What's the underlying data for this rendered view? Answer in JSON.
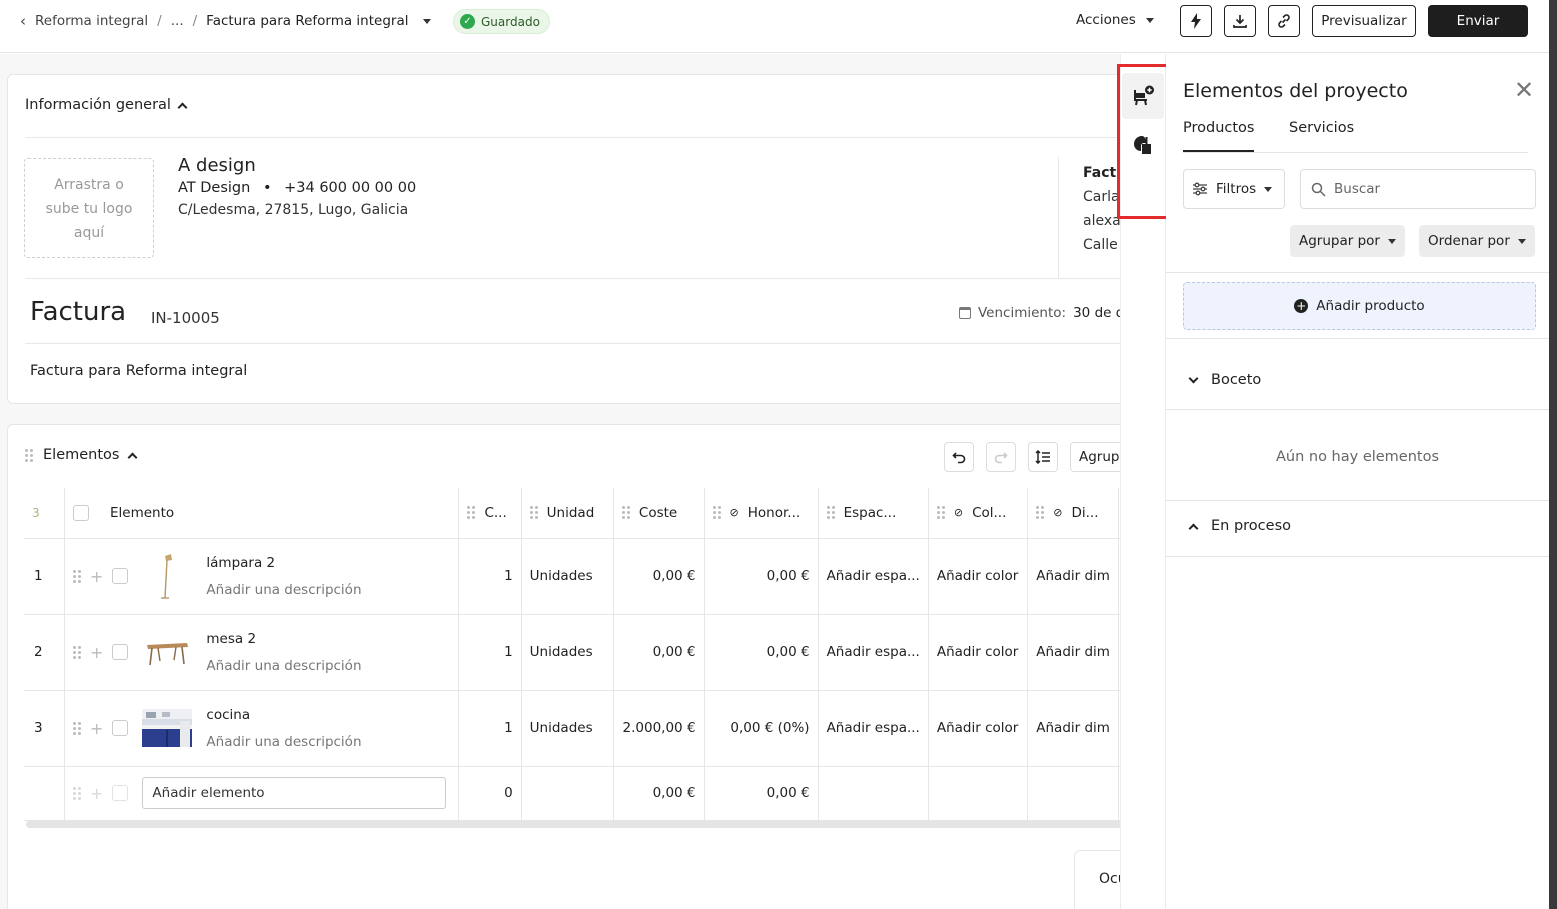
{
  "topbar": {
    "breadcrumb": [
      "Reforma integral",
      "...",
      "Factura para Reforma integral"
    ],
    "saved_label": "Guardado",
    "actions_label": "Acciones",
    "preview_label": "Previsualizar",
    "send_label": "Enviar"
  },
  "general": {
    "title": "Información general",
    "logo_placeholder": "Arrastra o sube tu logo aquí",
    "company_name": "A design",
    "company_legal": "AT Design",
    "company_phone": "+34 600 00 00 00",
    "company_address": "C/Ledesma, 27815, Lugo, Galicia",
    "client_peek": [
      "Fact",
      "Carla",
      "alexa",
      "Calle"
    ]
  },
  "invoice": {
    "title": "Factura",
    "number": "IN-10005",
    "due_label": "Vencimiento:",
    "due_value": "30 de d",
    "description": "Factura para Reforma integral"
  },
  "elements": {
    "title": "Elementos",
    "group_button": "Agrupa",
    "count": "3",
    "columns": [
      "Elemento",
      "C...",
      "Unidad",
      "Coste",
      "Honor...",
      "Espac...",
      "Col...",
      "Di..."
    ],
    "rows": [
      {
        "index": "1",
        "name": "lámpara 2",
        "desc": "Añadir una descripción",
        "qty": "1",
        "unit": "Unidades",
        "cost": "0,00 €",
        "fee": "0,00 €",
        "space": "Añadir espa...",
        "color": "Añadir color",
        "dim": "Añadir dim"
      },
      {
        "index": "2",
        "name": "mesa 2",
        "desc": "Añadir una descripción",
        "qty": "1",
        "unit": "Unidades",
        "cost": "0,00 €",
        "fee": "0,00 €",
        "space": "Añadir espa...",
        "color": "Añadir color",
        "dim": "Añadir dim"
      },
      {
        "index": "3",
        "name": "cocina",
        "desc": "Añadir una descripción",
        "qty": "1",
        "unit": "Unidades",
        "cost": "2.000,00 €",
        "fee": "0,00 € (0%)",
        "space": "Añadir espa...",
        "color": "Añadir color",
        "dim": "Añadir dim"
      }
    ],
    "add_row": {
      "placeholder": "Añadir elemento",
      "qty": "0",
      "cost": "0,00 €",
      "fee": "0,00 €"
    },
    "footer_peek": "Ocu"
  },
  "panel": {
    "title": "Elementos del proyecto",
    "tabs": [
      "Productos",
      "Servicios"
    ],
    "filters_label": "Filtros",
    "search_placeholder": "Buscar",
    "group_by": "Agrupar por",
    "order_by": "Ordenar por",
    "add_product": "Añadir producto",
    "groups": [
      {
        "name": "Boceto",
        "empty_text": "Aún no hay elementos"
      },
      {
        "name": "En proceso"
      }
    ]
  },
  "colors": {
    "primary_dark": "#1e1e1e",
    "saved_green": "#2fa84f",
    "highlight_red": "#e32b2b",
    "add_product_bg": "#eef3fd"
  }
}
